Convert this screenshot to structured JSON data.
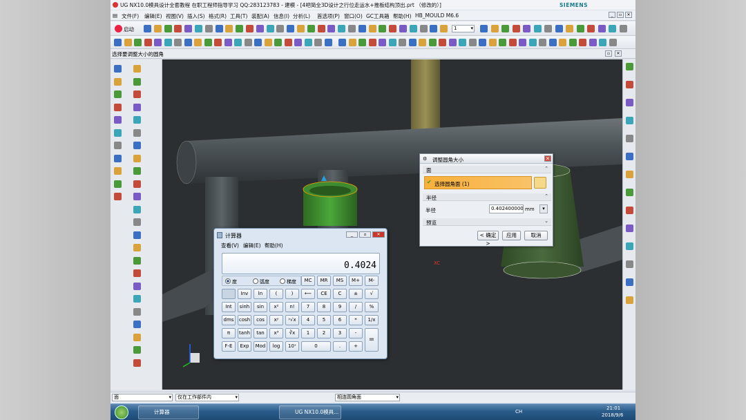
{
  "window": {
    "title": "UG NX10.0模具设计全套教程 在职工程师指导学习 QQ:283123783 - 建模 - [4吧简全3D设计之行位走运水+推板结构顶出.prt （修改的）]",
    "brand": "SIEMENS"
  },
  "menu": [
    "文件(F)",
    "编辑(E)",
    "视图(V)",
    "插入(S)",
    "格式(R)",
    "工具(T)",
    "装配(A)",
    "信息(I)",
    "分析(L)",
    "首选项(P)",
    "窗口(O)",
    "GC工具箱",
    "帮助(H)",
    "HB_MOULD M6.6"
  ],
  "toolbar": {
    "start_label": "启动",
    "layer_value": "1"
  },
  "status_prompt": "选择要调整大小的圆角",
  "dialog": {
    "title": "调整圆角大小",
    "section_face": "面",
    "select_face": "选择圆角面 (1)",
    "section_radius": "半径",
    "radius_label": "半径",
    "radius_value": "0.402400000",
    "radius_unit": "mm",
    "section_preview": "预览",
    "ok": "< 确定 >",
    "apply": "应用",
    "cancel": "取消"
  },
  "calculator": {
    "title": "计算器",
    "menu": [
      "查看(V)",
      "编辑(E)",
      "帮助(H)"
    ],
    "display": "0.4024",
    "modes": [
      "度",
      "弧度",
      "梯度"
    ],
    "keys": [
      [
        "",
        "Inv",
        "ln",
        "(",
        ")",
        "⟵",
        "CE",
        "C",
        "±",
        "√"
      ],
      [
        "Int",
        "sinh",
        "sin",
        "x²",
        "n!",
        "7",
        "8",
        "9",
        "/",
        "%"
      ],
      [
        "dms",
        "cosh",
        "cos",
        "xʸ",
        "ʸ√x",
        "4",
        "5",
        "6",
        "*",
        "1/x"
      ],
      [
        "π",
        "tanh",
        "tan",
        "x³",
        "∛x",
        "1",
        "2",
        "3",
        "-",
        "="
      ],
      [
        "F-E",
        "Exp",
        "Mod",
        "log",
        "10ˣ",
        "0",
        ".",
        "+"
      ]
    ],
    "memory_keys": [
      "MC",
      "MR",
      "MS",
      "M+",
      "M-"
    ]
  },
  "viewport": {
    "axis_label": "XC"
  },
  "bottom": {
    "filter1": "面",
    "filter2": "仅在工作部件内",
    "filter3": "相连圆角面"
  },
  "taskbar": {
    "calc": "计算器",
    "ugnx": "UG NX10.0模具...",
    "lang": "CH",
    "time": "21:01",
    "date": "2018/9/6"
  }
}
